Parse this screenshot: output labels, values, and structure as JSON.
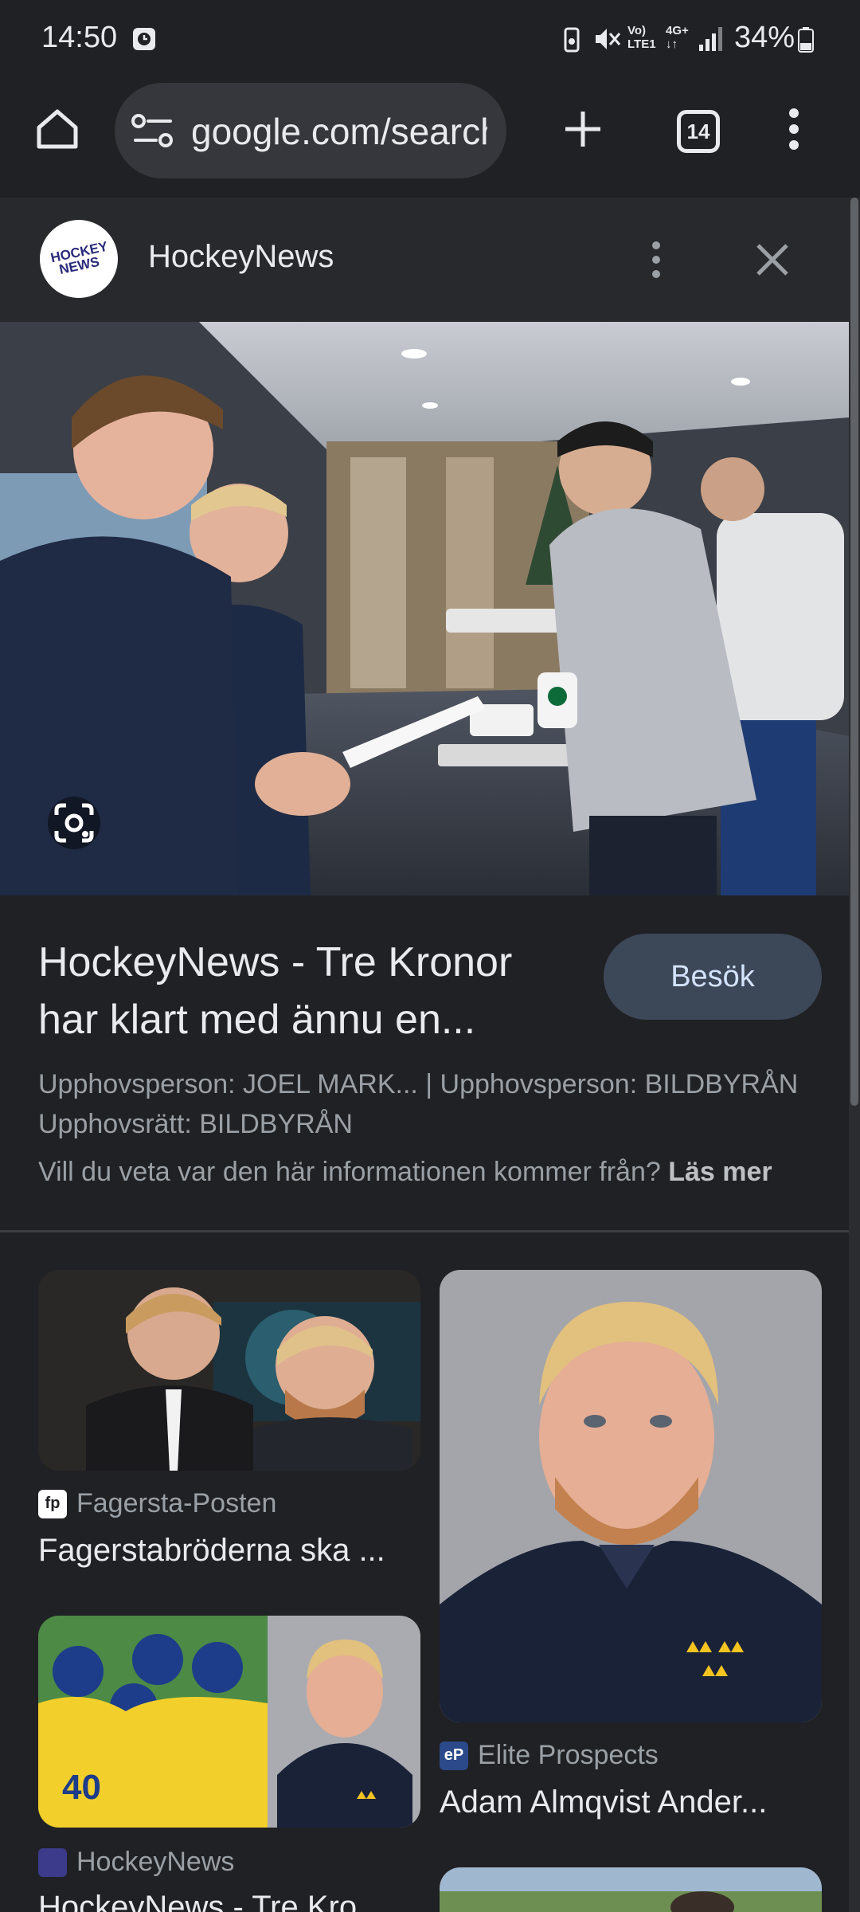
{
  "status_bar": {
    "time": "14:50",
    "network": "4G+",
    "lte": "LTE1",
    "battery": "34%"
  },
  "toolbar": {
    "url": "google.com/search",
    "tab_count": "14"
  },
  "source": {
    "name": "HockeyNews",
    "logo_line1": "HOCKEY",
    "logo_line2": "NEWS"
  },
  "result": {
    "title_line1": "HockeyNews - Tre Kronor",
    "title_line2": "har klart med ännu en...",
    "visit_label": "Besök",
    "credit_line1": "Upphovsperson: JOEL MARK... | Upphovsperson: BILDBYRÅN",
    "credit_line2": "Upphovsrätt: BILDBYRÅN",
    "info_prefix": "Vill du veta var den här informationen kommer från?",
    "info_link": "Läs mer"
  },
  "related": [
    {
      "source": "Fagersta-Posten",
      "favicon": "fp",
      "title": "Fagerstabröderna ska ..."
    },
    {
      "source": "Elite Prospects",
      "favicon": "eP",
      "title": "Adam Almqvist Ander..."
    },
    {
      "source": "HockeyNews",
      "favicon": "",
      "title": "HockeyNews - Tre Kro..."
    }
  ],
  "colors": {
    "background": "#202124",
    "visit_button": "#3c4758",
    "accent_text": "#d3e3fd"
  }
}
